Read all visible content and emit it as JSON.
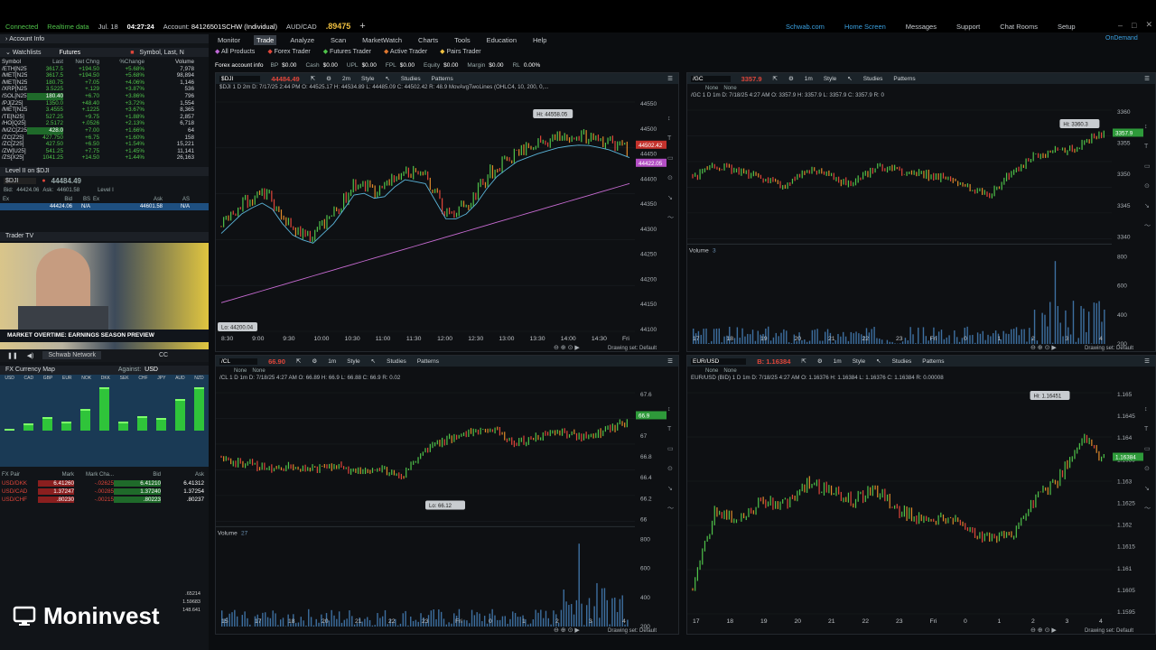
{
  "status": {
    "connected": "Connected",
    "realtime": "Realtime data",
    "date": "Jul. 18",
    "time": "04:27:24",
    "account_label": "Account:",
    "account": "84126501SCHW (Individual)",
    "pair": "AUD/CAD",
    "pair_price": ".89475"
  },
  "topright": {
    "schwab": "Schwab.com",
    "home": "Home Screen",
    "messages": "Messages",
    "support": "Support",
    "chat": "Chat Rooms",
    "setup": "Setup",
    "ondemand": "OnDemand"
  },
  "menu": [
    "Monitor",
    "Trade",
    "Analyze",
    "Scan",
    "MarketWatch",
    "Charts",
    "Tools",
    "Education",
    "Help"
  ],
  "submenu": [
    "All Products",
    "Forex Trader",
    "Futures Trader",
    "Active Trader",
    "Pairs Trader"
  ],
  "acct": {
    "label": "Forex account info",
    "items": [
      [
        "BP",
        "$0.00"
      ],
      [
        "Cash",
        "$0.00"
      ],
      [
        "UPL",
        "$0.00"
      ],
      [
        "FPL",
        "$0.00"
      ],
      [
        "Equity",
        "$0.00"
      ],
      [
        "Margin",
        "$0.00"
      ],
      [
        "RL",
        "0.00%"
      ]
    ]
  },
  "left": {
    "account_info": "Account Info",
    "watchlists": "Watchlists",
    "futures": "Futures",
    "symbol_search": "Symbol, Last, N",
    "cols": {
      "symbol": "Symbol",
      "last": "Last",
      "netchg": "Net Chng",
      "pctchg": "%Change",
      "volume": "Volume"
    },
    "rows": [
      {
        "s": "/ETH[N25]",
        "l": "3617.5",
        "c": "+194.50",
        "p": "+5.68%",
        "v": "7,978",
        "dir": "up"
      },
      {
        "s": "/MET[N25]",
        "l": "3617.5",
        "c": "+194.50",
        "p": "+5.68%",
        "v": "98,894",
        "dir": "up"
      },
      {
        "s": "/MET[N25]",
        "l": "180.75",
        "c": "+7.05",
        "p": "+4.06%",
        "v": "1,146",
        "dir": "up"
      },
      {
        "s": "/XRP[N25]",
        "l": "3.5225",
        "c": "+.129",
        "p": "+3.87%",
        "v": "536",
        "dir": "up"
      },
      {
        "s": "/SOL[N25]",
        "l": "180.40",
        "c": "+6.70",
        "p": "+3.86%",
        "v": "796",
        "dir": "up",
        "hl": true
      },
      {
        "s": "/PJ[Z25]",
        "l": "1350.0",
        "c": "+48.40",
        "p": "+3.72%",
        "v": "1,554",
        "dir": "up"
      },
      {
        "s": "/MET[N25]",
        "l": "3.4555",
        "c": "+.1225",
        "p": "+3.67%",
        "v": "8,365",
        "dir": "up"
      },
      {
        "s": "/TE[N25]",
        "l": "527.25",
        "c": "+9.75",
        "p": "+1.88%",
        "v": "2,857",
        "dir": "up"
      },
      {
        "s": "/HO[Q25]",
        "l": "2.5172",
        "c": "+.0526",
        "p": "+2.13%",
        "v": "6,718",
        "dir": "up"
      },
      {
        "s": "/MZC[Z25]",
        "l": "428.0",
        "c": "+7.00",
        "p": "+1.66%",
        "v": "64",
        "dir": "up",
        "hl": true
      },
      {
        "s": "/ZC[Z25]",
        "l": "427.750",
        "c": "+6.75",
        "p": "+1.60%",
        "v": "158",
        "dir": "up"
      },
      {
        "s": "/ZC[Z25]",
        "l": "427.50",
        "c": "+6.50",
        "p": "+1.54%",
        "v": "15,221",
        "dir": "up"
      },
      {
        "s": "/ZW[U25]",
        "l": "541.25",
        "c": "+7.75",
        "p": "+1.45%",
        "v": "11,141",
        "dir": "up"
      },
      {
        "s": "/ZS[X25]",
        "l": "1041.25",
        "c": "+14.50",
        "p": "+1.44%",
        "v": "26,163",
        "dir": "up"
      }
    ],
    "level2_title": "Level II on $DJI",
    "level2_symbol": "$DJI",
    "level2_price": "44484.49",
    "bid_label": "Bid:",
    "bid": "44424.06",
    "ask_label": "Ask:",
    "ask": "44601.58",
    "level1": "Level I",
    "l2cols": [
      "Ex",
      "Bid",
      "BS",
      "Ex",
      "Ask",
      "AS"
    ],
    "l2row": [
      "",
      "44424.06",
      "N/A",
      "",
      "44601.58",
      "N/A"
    ],
    "tradertv": "Trader TV",
    "tv_caption": "MARKET OVERTIME: EARNINGS SEASON PREVIEW",
    "network": "Schwab Network",
    "fxmap": "FX Currency Map",
    "against": "Against:",
    "against_ccy": "USD",
    "currencies": [
      "USD",
      "CAD",
      "GBP",
      "EUR",
      "NOK",
      "DKK",
      "SEK",
      "CHF",
      "JPY",
      "AUD",
      "NZD"
    ],
    "fx_bars": [
      0,
      15,
      30,
      20,
      48,
      95,
      20,
      32,
      28,
      70,
      95
    ],
    "fxcols": [
      "FX Pair",
      "Mark",
      "Mark Cha...",
      "Bid",
      "Ask"
    ],
    "fxrows": [
      [
        "USD/DKK",
        "6.41260",
        "-.02625",
        "6.41210",
        "6.41312"
      ],
      [
        "USD/CAD",
        "1.37247",
        "-.00285",
        "1.37240",
        "1.37254"
      ],
      [
        "USD/CHF",
        ".80230",
        "-.00215",
        ".80223",
        ".80237"
      ]
    ],
    "fx_extra": [
      ".65214",
      "1.59683",
      "148.641"
    ]
  },
  "logo": "Moninvest",
  "charts": [
    {
      "id": "dji",
      "symbol": "$DJI",
      "price": "44484.49",
      "info": "$DJI 1 D 2m  D: 7/17/25 2:44 PM  O: 44525.17  H: 44534.89  L: 44485.09  C: 44502.42  R: 48.9  MovAvgTwoLines (OHLC4, 10, 200, 0,...",
      "hi": "Hi: 44558.05",
      "lo": "Lo: 44200.04",
      "last_tag": "44502.42",
      "ma_tag": "44422.05",
      "yticks": [
        "44550",
        "44500",
        "44450",
        "44400",
        "44350",
        "44300",
        "44250",
        "44200",
        "44150",
        "44100"
      ],
      "xticks": [
        "8:30",
        "9:00",
        "9:30",
        "10:00",
        "10:30",
        "11:00",
        "11:30",
        "12:00",
        "12:30",
        "13:00",
        "13:30",
        "14:00",
        "14:30",
        "Fri"
      ],
      "drawing": "Drawing set: Default"
    },
    {
      "id": "gc",
      "symbol": "/GC",
      "price": "3357.9",
      "info": "/GC 1 D 1m  D: 7/18/25 4:27 AM  O: 3357.9  H: 3357.9  L: 3357.9  C: 3357.9  R: 0",
      "hi": "Hi: 3360.3",
      "last_tag": "3357.9",
      "volume": "Volume",
      "vol_val": "3",
      "yticks": [
        "3360",
        "3355",
        "3350",
        "3345",
        "3340"
      ],
      "vticks": [
        "800",
        "600",
        "400",
        "200"
      ],
      "xticks": [
        "17",
        "18",
        "19",
        "20",
        "21",
        "22",
        "23",
        "Fri",
        "0",
        "1",
        "2",
        "3",
        "4"
      ],
      "drawing": "Drawing set: Default"
    },
    {
      "id": "cl",
      "symbol": "/CL",
      "price": "66.90",
      "info": "/CL 1 D 1m  D: 7/18/25 4:27 AM  O: 66.89  H: 66.9  L: 66.88  C: 66.9  R: 0.02",
      "lo": "Lo: 66.12",
      "last_tag": "66.9",
      "volume": "Volume",
      "vol_val": "27",
      "yticks": [
        "67.6",
        "67.4",
        "67",
        "66.8",
        "66.4",
        "66.2",
        "66"
      ],
      "vticks": [
        "800",
        "600",
        "400",
        "200"
      ],
      "xticks": [
        "15",
        "17",
        "18",
        "20",
        "21",
        "22",
        "23",
        "Fri",
        "0",
        "1",
        "2",
        "3",
        "4"
      ],
      "drawing": "Drawing set: Default"
    },
    {
      "id": "eur",
      "symbol": "EUR/USD",
      "price": "B: 1.16384",
      "info": "EUR/USD (BID) 1 D 1m  D: 7/18/25 4:27 AM  O: 1.16376  H: 1.16384  L: 1.16376  C: 1.16384  R: 0.00008",
      "hi": "Hi: 1.16451",
      "last_tag": "1.16384",
      "yticks": [
        "1.165",
        "1.1645",
        "1.164",
        "1.1635",
        "1.163",
        "1.1625",
        "1.162",
        "1.1615",
        "1.161",
        "1.1605",
        "1.1595"
      ],
      "xticks": [
        "17",
        "18",
        "19",
        "20",
        "21",
        "22",
        "23",
        "Fri",
        "0",
        "1",
        "2",
        "3",
        "4"
      ],
      "drawing": "Drawing set: Default"
    }
  ],
  "toolbar": {
    "style": "Style",
    "studies": "Studies",
    "patterns": "Patterns",
    "none": "None",
    "tf": "2m",
    "tf1": "1m"
  },
  "colors": {
    "up": "#4fc34a",
    "down": "#e0463a",
    "ma_short": "#5ab4d8",
    "ma_long": "#c76bd2",
    "accent": "#3aa0e0"
  }
}
